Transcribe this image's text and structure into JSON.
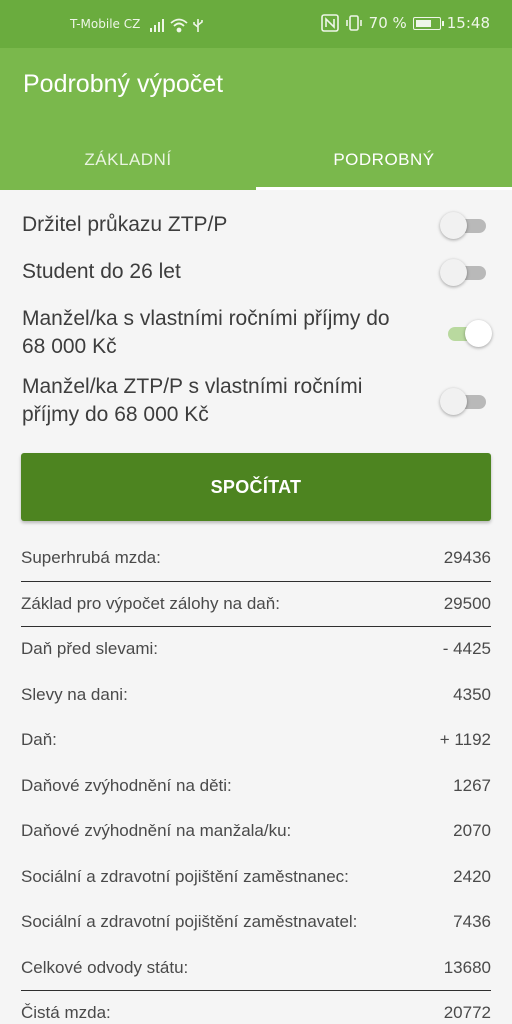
{
  "status_bar": {
    "carrier": "T-Mobile CZ",
    "battery_text": "70 %",
    "battery_level": 0.7,
    "time": "15:48",
    "icons": [
      "signal-icon",
      "wifi-icon",
      "usb-icon",
      "nfc-icon",
      "vibrate-icon",
      "battery-icon"
    ]
  },
  "app_bar": {
    "title": "Podrobný výpočet",
    "tabs": [
      {
        "label": "ZÁKLADNÍ",
        "active": false
      },
      {
        "label": "PODROBNÝ",
        "active": true
      }
    ]
  },
  "toggles": [
    {
      "label": "Držitel průkazu ZTP/P",
      "on": false
    },
    {
      "label": "Student do 26 let",
      "on": false
    },
    {
      "label": "Manžel/ka s vlastními ročními příjmy do 68 000 Kč",
      "on": true
    },
    {
      "label": "Manžel/ka ZTP/P s vlastními ročními příjmy do 68 000 Kč",
      "on": false
    }
  ],
  "calculate_button": {
    "label": "SPOČÍTAT"
  },
  "results": [
    {
      "label": "Superhrubá mzda:",
      "value": "29436"
    },
    {
      "label": "Základ pro výpočet zálohy na daň:",
      "value": "29500"
    },
    {
      "label": "Daň před slevami:",
      "value": "- 4425"
    },
    {
      "label": "Slevy na dani:",
      "value": "4350"
    },
    {
      "label": "Daň:",
      "value": "+ 1192"
    },
    {
      "label": "Daňové zvýhodnění na děti:",
      "value": "1267"
    },
    {
      "label": "Daňové zvýhodnění na manžala/ku:",
      "value": "2070"
    },
    {
      "label": "Sociální a zdravotní pojištění zaměstnanec:",
      "value": "2420"
    },
    {
      "label": "Sociální a zdravotní pojištění zaměstnavatel:",
      "value": "7436"
    },
    {
      "label": "Celkové odvody státu:",
      "value": "13680"
    },
    {
      "label": "Čistá mzda:",
      "value": "20772"
    }
  ],
  "colors": {
    "status_bar": "#6aac3e",
    "app_bar": "#7ab84c",
    "button": "#4d8420",
    "switch_on_track": "#b9d99f"
  }
}
